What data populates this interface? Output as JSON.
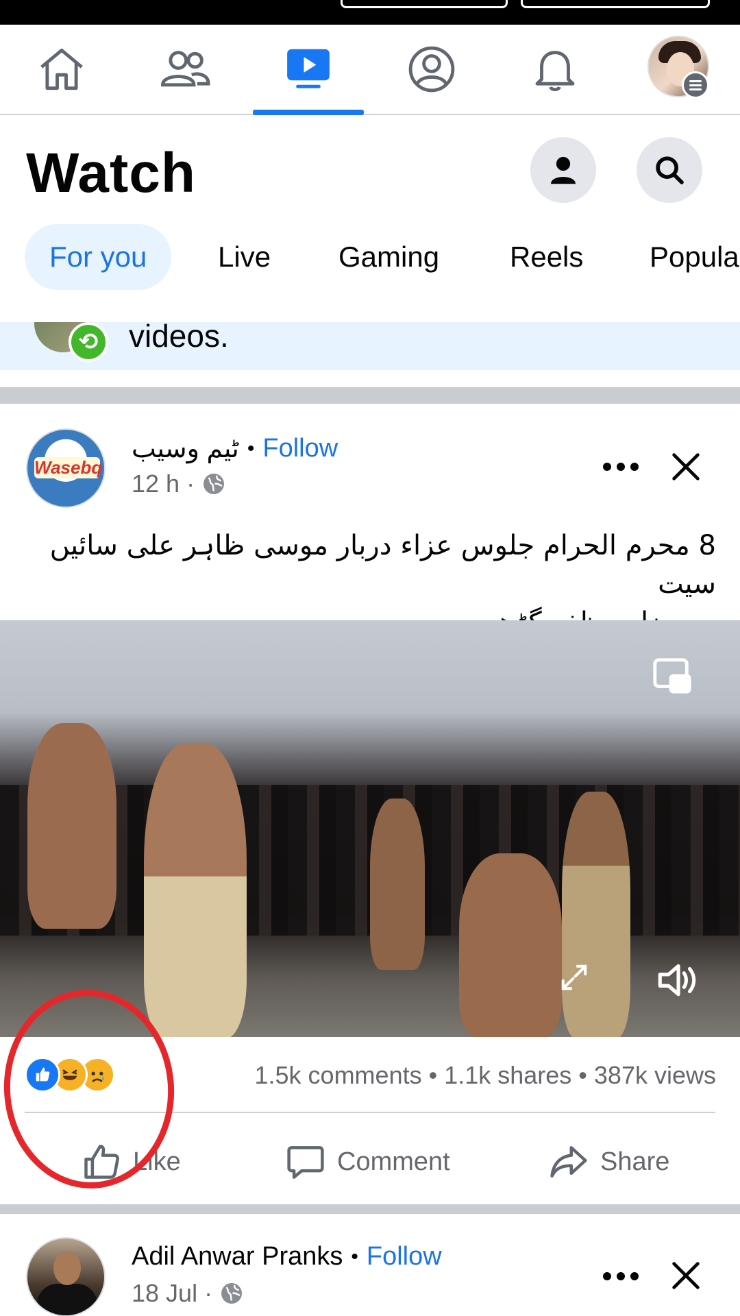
{
  "nav": {
    "tabs": [
      "home-icon",
      "friends-icon",
      "watch-icon",
      "profile-icon",
      "notifications-icon",
      "menu-avatar"
    ],
    "active": "watch-icon",
    "accent": "#1877f2"
  },
  "header": {
    "title": "Watch"
  },
  "chips": [
    "For you",
    "Live",
    "Gaming",
    "Reels",
    "Popula"
  ],
  "banner": {
    "text": "videos."
  },
  "posts": [
    {
      "page_name": "ٹیم وسیب",
      "separator": "•",
      "follow": "Follow",
      "time": "12 h ·",
      "logo_word": "Wasebq",
      "text_line1": "8 محرم الحرام جلوس عزاء دربار موسی ظاہر علی سائیں سیت",
      "text_line2": "پور ضلع مظفر گڑھ",
      "stats": "1.5k comments • 1.1k shares • 387k views",
      "reactions": [
        "like-reaction-icon",
        "haha-reaction-icon",
        "sad-reaction-icon"
      ],
      "actions": {
        "like": "Like",
        "comment": "Comment",
        "share": "Share"
      }
    },
    {
      "page_name": "Adil Anwar Pranks",
      "separator": "•",
      "follow": "Follow",
      "time": "18 Jul ·"
    }
  ],
  "colors": {
    "link": "#1b74e4",
    "chip_active_bg": "#e7f3ff",
    "annotation": "#e5272b"
  }
}
